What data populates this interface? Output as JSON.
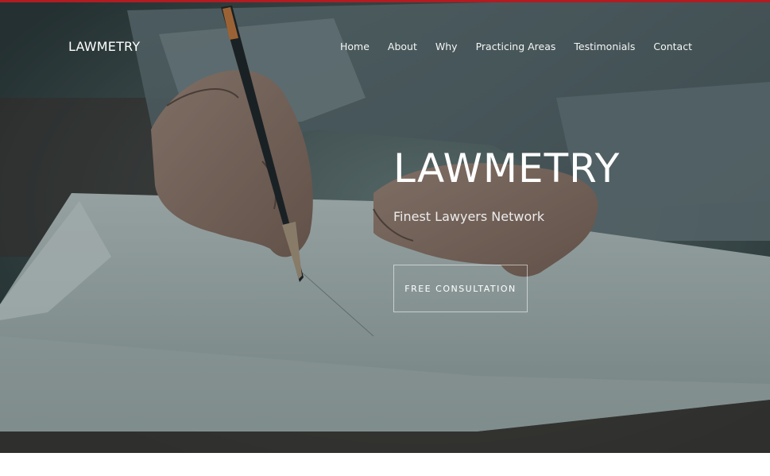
{
  "brand": {
    "name": "LAWMETRY"
  },
  "nav": {
    "items": [
      {
        "label": "Home"
      },
      {
        "label": "About"
      },
      {
        "label": "Why"
      },
      {
        "label": "Practicing Areas"
      },
      {
        "label": "Testimonials"
      },
      {
        "label": "Contact"
      }
    ]
  },
  "hero": {
    "title": "LAWMETRY",
    "subtitle": "Finest Lawyers Network",
    "cta_label": "FREE CONSULTATION",
    "image_icon": "hero-photo-writing-document"
  },
  "colors": {
    "accent": "#b01c22",
    "text": "#ffffff"
  }
}
